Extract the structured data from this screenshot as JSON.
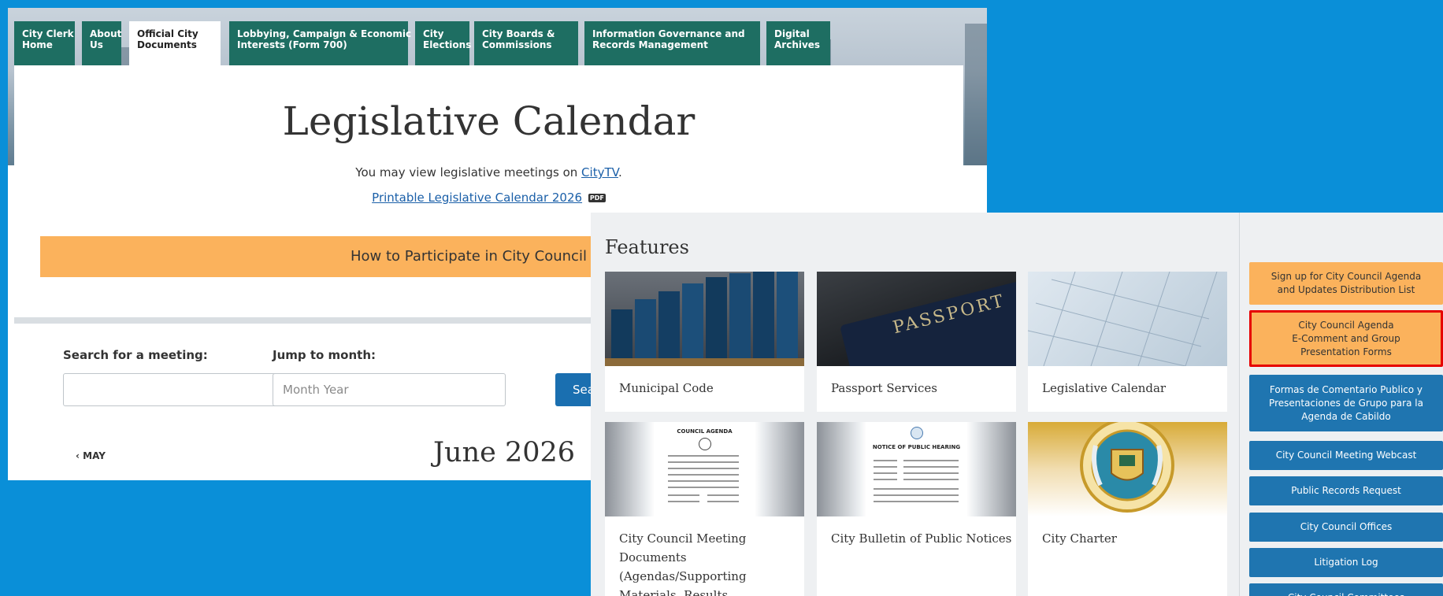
{
  "nav": {
    "tabs": [
      {
        "label": "City Clerk\nHome"
      },
      {
        "label": "About\nUs"
      },
      {
        "label": "Official City\nDocuments"
      },
      {
        "label": "Lobbying, Campaign & Economic\nInterests (Form 700)"
      },
      {
        "label": "City\nElections"
      },
      {
        "label": "City Boards &\nCommissions"
      },
      {
        "label": "Information Governance and\nRecords Management"
      },
      {
        "label": "Digital\nArchives"
      }
    ],
    "active_index": 2
  },
  "page": {
    "title": "Legislative Calendar",
    "view_text": "You may view legislative meetings on",
    "view_link": "CityTV",
    "view_end": ".",
    "printable_link": "Printable Legislative Calendar 2026",
    "pdf_badge": "PDF",
    "participate_banner": "How to Participate in City Council Meetings"
  },
  "search": {
    "search_label": "Search for a meeting:",
    "search_value": "",
    "jump_label": "Jump to month:",
    "jump_placeholder": "Month Year",
    "button_label": "Search"
  },
  "calendar": {
    "prev_label": "‹ MAY",
    "current_month": "June 2026"
  },
  "features": {
    "heading": "Features",
    "cards": [
      {
        "caption": "Municipal Code"
      },
      {
        "caption": "Passport Services"
      },
      {
        "caption": "Legislative Calendar"
      },
      {
        "caption": "City Council Meeting Documents (Agendas/Supporting Materials, Results Summaries,"
      },
      {
        "caption": "City Bulletin of Public Notices"
      },
      {
        "caption": "City Charter"
      }
    ],
    "doc_titles": [
      "COUNCIL AGENDA",
      "NOTICE OF PUBLIC HEARING"
    ],
    "passport_text": "PASSPORT"
  },
  "sidebar": {
    "buttons": [
      {
        "label": "Sign up for City Council Agenda\nand Updates Distribution List"
      },
      {
        "label": "City Council Agenda\nE-Comment and Group\nPresentation Forms"
      },
      {
        "label": "Formas de Comentario Publico y\nPresentaciones de Grupo para la\nAgenda de Cabildo"
      },
      {
        "label": "City Council Meeting Webcast"
      },
      {
        "label": "Public Records Request"
      },
      {
        "label": "City Council Offices"
      },
      {
        "label": "Litigation Log"
      },
      {
        "label": "City Council Committees"
      }
    ]
  },
  "colors": {
    "background": "#0a8fd8",
    "nav_green": "#1e6e62",
    "orange": "#fbb25c",
    "button_blue": "#1f75b0",
    "highlight_red": "#e60000"
  }
}
